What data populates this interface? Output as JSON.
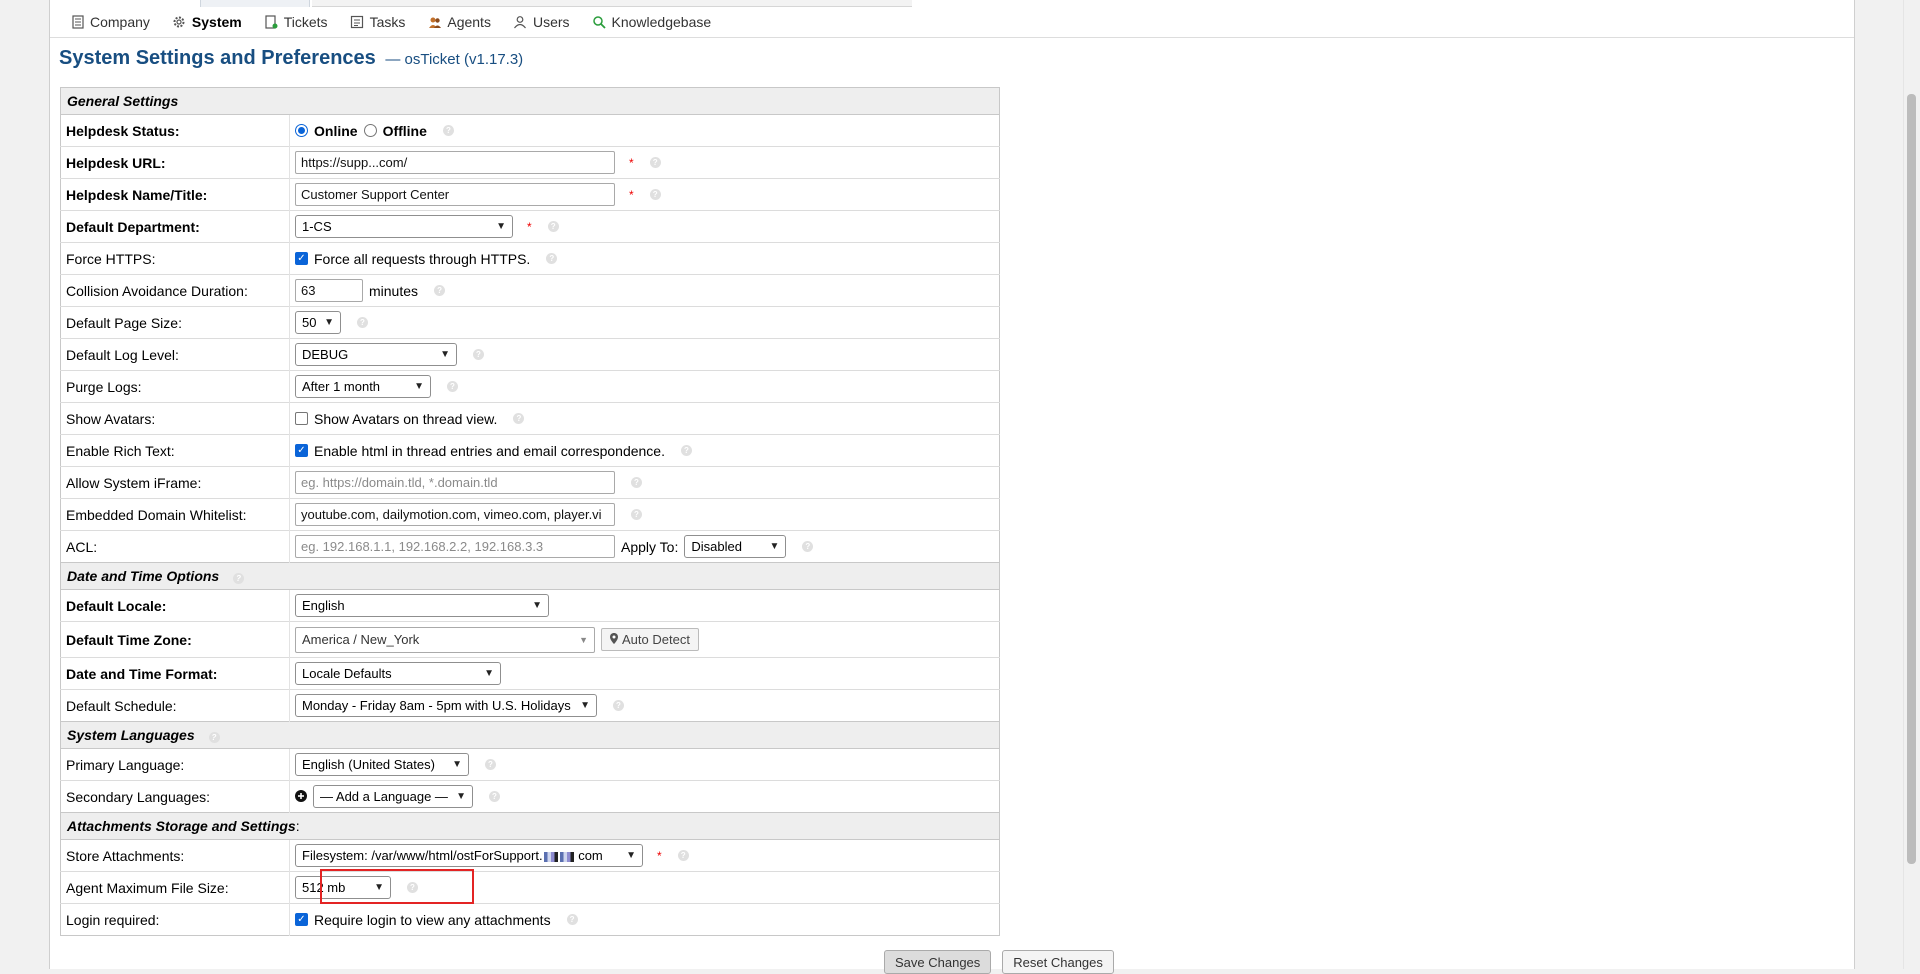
{
  "subnav": {
    "items": [
      {
        "label": "Company",
        "icon": "company-icon"
      },
      {
        "label": "System",
        "icon": "gear-icon"
      },
      {
        "label": "Tickets",
        "icon": "ticket-icon"
      },
      {
        "label": "Tasks",
        "icon": "tasks-icon"
      },
      {
        "label": "Agents",
        "icon": "agents-icon"
      },
      {
        "label": "Users",
        "icon": "users-icon"
      },
      {
        "label": "Knowledgebase",
        "icon": "knowledgebase-icon"
      }
    ]
  },
  "page": {
    "title": "System Settings and Preferences",
    "subtitle": "— osTicket (v1.17.3)"
  },
  "general": {
    "section": "General Settings",
    "helpdesk_status_label": "Helpdesk Status:",
    "online_label": "Online",
    "offline_label": "Offline",
    "helpdesk_url_label": "Helpdesk URL:",
    "helpdesk_url_value": "https://supp...com/",
    "helpdesk_name_label": "Helpdesk Name/Title:",
    "helpdesk_name_value": "Customer Support Center",
    "default_department_label": "Default Department:",
    "default_department_value": "1-CS",
    "force_https_label": "Force HTTPS:",
    "force_https_text": "Force all requests through HTTPS.",
    "collision_label": "Collision Avoidance Duration:",
    "collision_value": "63",
    "collision_unit": "minutes",
    "page_size_label": "Default Page Size:",
    "page_size_value": "50",
    "log_level_label": "Default Log Level:",
    "log_level_value": "DEBUG",
    "purge_logs_label": "Purge Logs:",
    "purge_logs_value": "After 1 month",
    "show_avatars_label": "Show Avatars:",
    "show_avatars_text": "Show Avatars on thread view.",
    "rich_text_label": "Enable Rich Text:",
    "rich_text_text": "Enable html in thread entries and email correspondence.",
    "iframe_label": "Allow System iFrame:",
    "iframe_placeholder": "eg. https://domain.tld, *.domain.tld",
    "whitelist_label": "Embedded Domain Whitelist:",
    "whitelist_value": "youtube.com, dailymotion.com, vimeo.com, player.vi",
    "acl_label": "ACL:",
    "acl_placeholder": "eg. 192.168.1.1, 192.168.2.2, 192.168.3.3",
    "apply_to_label": "Apply To:",
    "apply_to_value": "Disabled"
  },
  "datetime": {
    "section": "Date and Time Options",
    "locale_label": "Default Locale:",
    "locale_value": "English",
    "timezone_label": "Default Time Zone:",
    "timezone_value": "America / New_York",
    "auto_detect_label": "Auto Detect",
    "format_label": "Date and Time Format:",
    "format_value": "Locale Defaults",
    "schedule_label": "Default Schedule:",
    "schedule_value": "Monday - Friday 8am - 5pm with U.S. Holidays"
  },
  "languages": {
    "section": "System Languages",
    "primary_label": "Primary Language:",
    "primary_value": "English (United States)",
    "secondary_label": "Secondary Languages:",
    "secondary_value": "— Add a Language —"
  },
  "attachments": {
    "section": "Attachments Storage and Settings",
    "store_label": "Store Attachments:",
    "store_value": "Filesystem: /var/www/html/ostForSupport.",
    "store_suffix": "com",
    "max_size_label": "Agent Maximum File Size:",
    "max_size_value": "512 mb",
    "login_label": "Login required:",
    "login_text": "Require login to view any attachments"
  },
  "actions": {
    "save_label": "Save Changes",
    "reset_label": "Reset Changes"
  }
}
